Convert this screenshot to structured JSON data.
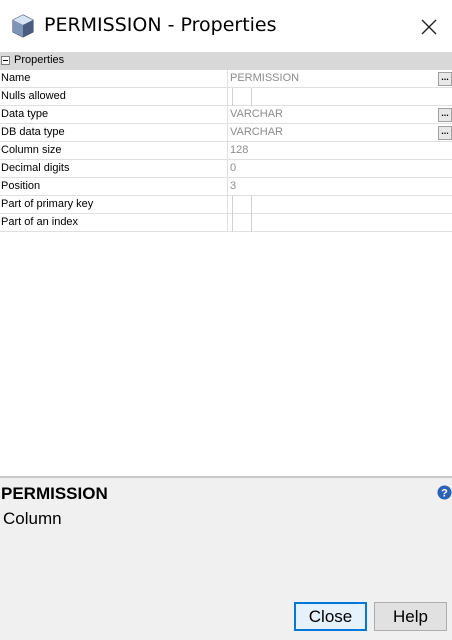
{
  "window": {
    "title": "PERMISSION - Properties"
  },
  "icons": {
    "app": "cube-icon",
    "close": "close-icon",
    "help": "help-icon"
  },
  "grid": {
    "group_label": "Properties",
    "rows": [
      {
        "name": "Name",
        "value": "PERMISSION",
        "type": "text",
        "has_ellipsis": true
      },
      {
        "name": "Nulls allowed",
        "value": "",
        "type": "checkbox",
        "has_ellipsis": false
      },
      {
        "name": "Data type",
        "value": "VARCHAR",
        "type": "text",
        "has_ellipsis": true
      },
      {
        "name": "DB data type",
        "value": "VARCHAR",
        "type": "text",
        "has_ellipsis": true
      },
      {
        "name": "Column size",
        "value": "128",
        "type": "text",
        "has_ellipsis": false
      },
      {
        "name": "Decimal digits",
        "value": "0",
        "type": "text",
        "has_ellipsis": false
      },
      {
        "name": "Position",
        "value": "3",
        "type": "text",
        "has_ellipsis": false
      },
      {
        "name": "Part of primary key",
        "value": "",
        "type": "checkbox",
        "has_ellipsis": false
      },
      {
        "name": "Part of an index",
        "value": "",
        "type": "checkbox",
        "has_ellipsis": false
      }
    ],
    "ellipsis_label": "..."
  },
  "description": {
    "title": "PERMISSION",
    "subtitle": "Column"
  },
  "buttons": {
    "close": "Close",
    "help": "Help"
  },
  "colors": {
    "accent": "#0078d7",
    "help_icon": "#2b62b8",
    "header_bg": "#d8d8d8",
    "panel_bg": "#f0f0f0"
  }
}
